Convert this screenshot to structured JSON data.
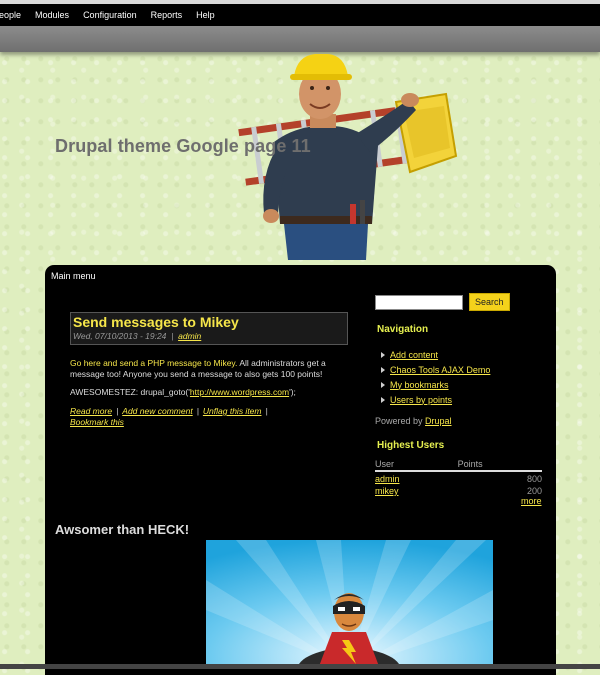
{
  "admin_menu": [
    "People",
    "Modules",
    "Configuration",
    "Reports",
    "Help"
  ],
  "site_name": "Drupal theme Google page 11",
  "main_menu_label": "Main menu",
  "node": {
    "title": "Send messages to Mikey",
    "date": "Wed, 07/10/2013 - 19:24",
    "author": "admin",
    "body_p1_highlight": "Go here and send a PHP message to Mikey.",
    "body_p1_rest": " All administrators get a message too! Anyone you send a message to also gets 100 points!",
    "body_p2_prefix": "AWESOMESTEZ: drupal_goto('",
    "body_p2_link": "http://www.wordpress.com",
    "body_p2_suffix": "');",
    "links": [
      "Read more",
      "Add new comment",
      "Unflag this item",
      "Bookmark this"
    ]
  },
  "sidebar": {
    "search_placeholder": "",
    "search_button": "Search",
    "navigation_title": "Navigation",
    "navigation_items": [
      "Add content",
      "Chaos Tools AJAX Demo",
      "My bookmarks",
      "Users by points"
    ],
    "powered_by_prefix": "Powered by ",
    "powered_by_link": "Drupal",
    "highest_users_title": "Highest Users",
    "table_headers": [
      "User",
      "Points"
    ],
    "rows": [
      {
        "user": "admin",
        "points": "800"
      },
      {
        "user": "mikey",
        "points": "200"
      }
    ],
    "more_link": "more"
  },
  "awesome_title": "Awsomer than HECK!",
  "colors": {
    "accent_yellow": "#f6e64a",
    "page_bg": "#dfeebf",
    "panel_bg": "#000000"
  }
}
